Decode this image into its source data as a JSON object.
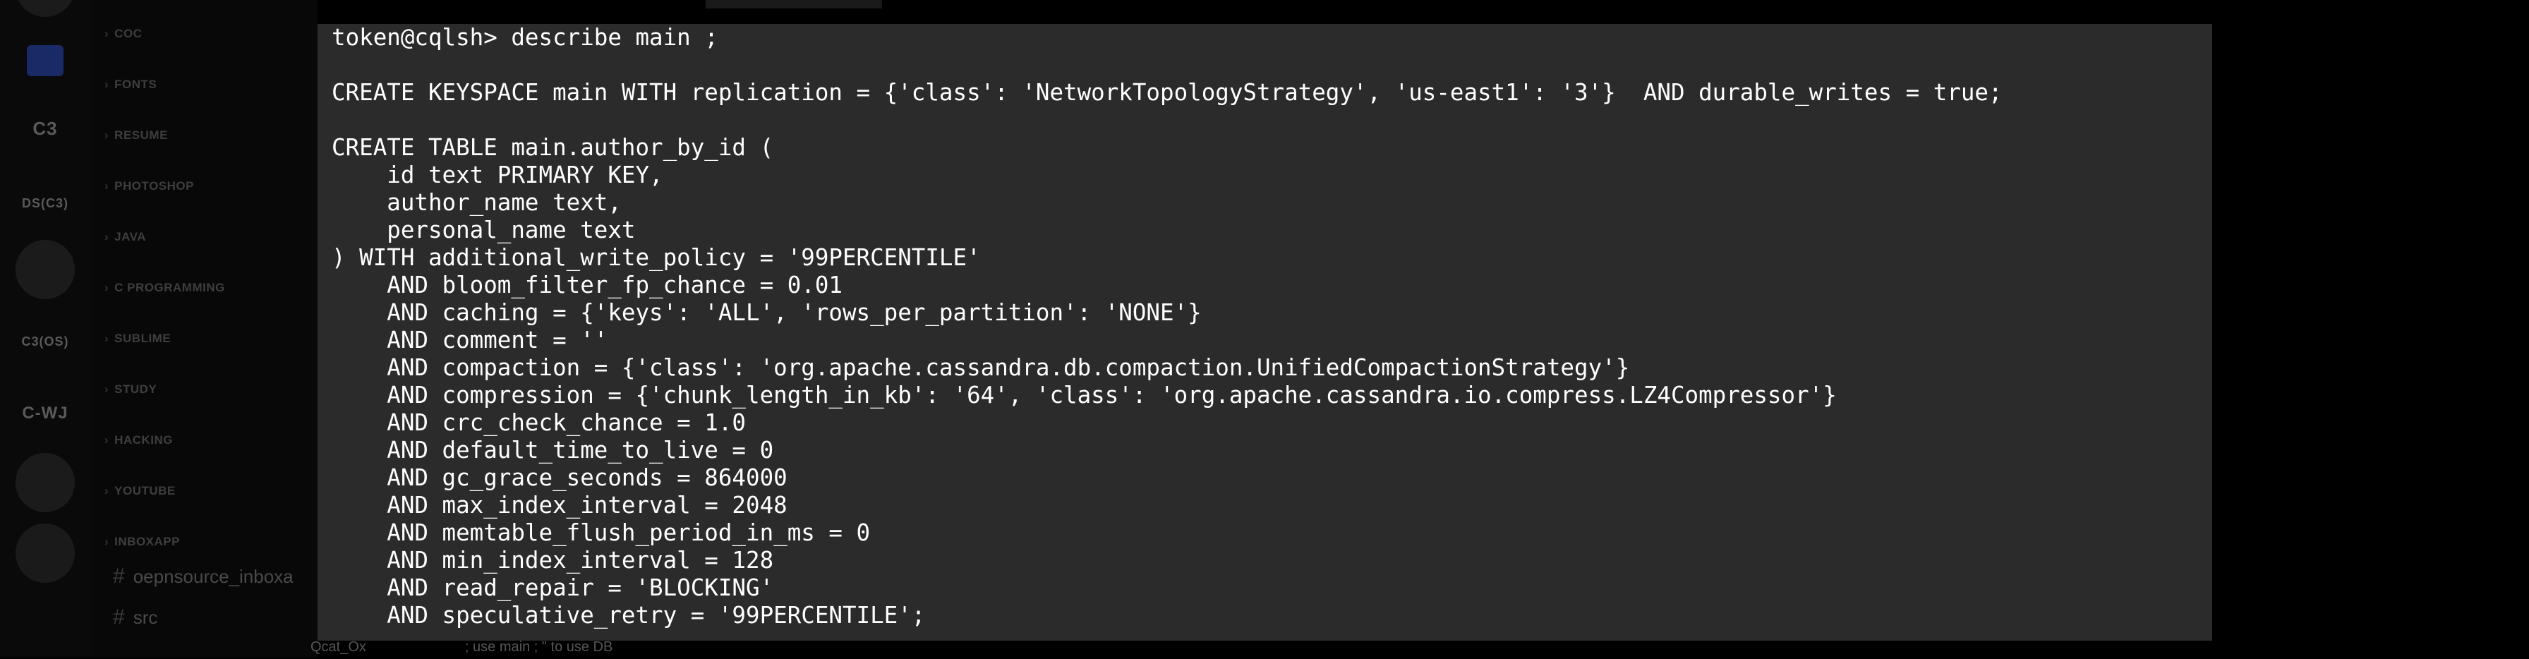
{
  "sidebar": {
    "servers": [
      "C3",
      "DS(C3)",
      "C3(OS)",
      "C-WJ"
    ],
    "categories": [
      "COC",
      "FONTS",
      "RESUME",
      "PHOTOSHOP",
      "JAVA",
      "C PROGRAMMING",
      "SUBLIME",
      "STUDY",
      "HACKING",
      "YOUTUBE",
      "INBOXAPP"
    ],
    "channels": [
      "oepnsource_inboxa",
      "src"
    ]
  },
  "chat": {
    "author": "Qcat_Ox",
    "message": "; use main ; \" to use DB"
  },
  "terminal": {
    "lines": [
      "token@cqlsh> describe main ;",
      "",
      "CREATE KEYSPACE main WITH replication = {'class': 'NetworkTopologyStrategy', 'us-east1': '3'}  AND durable_writes = true;",
      "",
      "CREATE TABLE main.author_by_id (",
      "    id text PRIMARY KEY,",
      "    author_name text,",
      "    personal_name text",
      ") WITH additional_write_policy = '99PERCENTILE'",
      "    AND bloom_filter_fp_chance = 0.01",
      "    AND caching = {'keys': 'ALL', 'rows_per_partition': 'NONE'}",
      "    AND comment = ''",
      "    AND compaction = {'class': 'org.apache.cassandra.db.compaction.UnifiedCompactionStrategy'}",
      "    AND compression = {'chunk_length_in_kb': '64', 'class': 'org.apache.cassandra.io.compress.LZ4Compressor'}",
      "    AND crc_check_chance = 1.0",
      "    AND default_time_to_live = 0",
      "    AND gc_grace_seconds = 864000",
      "    AND max_index_interval = 2048",
      "    AND memtable_flush_period_in_ms = 0",
      "    AND min_index_interval = 128",
      "    AND read_repair = 'BLOCKING'",
      "    AND speculative_retry = '99PERCENTILE';"
    ]
  }
}
